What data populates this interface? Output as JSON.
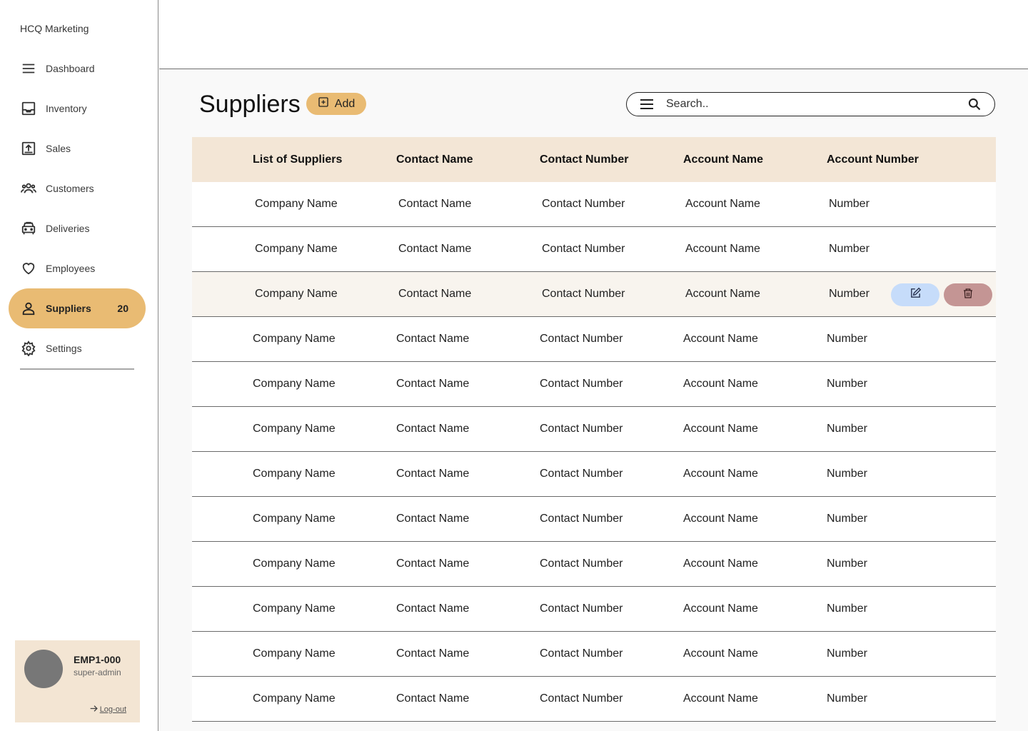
{
  "brand": "HCQ Marketing",
  "nav": [
    {
      "label": "Dashboard",
      "icon": "menu-icon"
    },
    {
      "label": "Inventory",
      "icon": "inbox-icon"
    },
    {
      "label": "Sales",
      "icon": "upload-box-icon"
    },
    {
      "label": "Customers",
      "icon": "people-icon"
    },
    {
      "label": "Deliveries",
      "icon": "car-icon"
    },
    {
      "label": "Employees",
      "icon": "heart-icon"
    },
    {
      "label": "Suppliers",
      "icon": "person-icon",
      "badge": "20",
      "active": true
    },
    {
      "label": "Settings",
      "icon": "gear-icon"
    }
  ],
  "user": {
    "id": "EMP1-000",
    "role": "super-admin",
    "logout_label": "Log-out"
  },
  "page": {
    "title": "Suppliers",
    "add_label": "Add"
  },
  "search": {
    "placeholder": "Search..",
    "value": ""
  },
  "table": {
    "headers": [
      "List of Suppliers",
      "Contact Name",
      "Contact Number",
      "Account Name",
      "Account Number"
    ],
    "rows": [
      [
        "Company Name",
        "Contact Name",
        "Contact Number",
        "Account Name",
        "Number"
      ],
      [
        "Company Name",
        "Contact Name",
        "Contact Number",
        "Account Name",
        "Number"
      ],
      [
        "Company Name",
        "Contact Name",
        "Contact Number",
        "Account Name",
        "Number"
      ],
      [
        "Company Name",
        "Contact Name",
        "Contact Number",
        "Account Name",
        "Number"
      ],
      [
        "Company Name",
        "Contact Name",
        "Contact Number",
        "Account Name",
        "Number"
      ],
      [
        "Company Name",
        "Contact Name",
        "Contact Number",
        "Account Name",
        "Number"
      ],
      [
        "Company Name",
        "Contact Name",
        "Contact Number",
        "Account Name",
        "Number"
      ],
      [
        "Company Name",
        "Contact Name",
        "Contact Number",
        "Account Name",
        "Number"
      ],
      [
        "Company Name",
        "Contact Name",
        "Contact Number",
        "Account Name",
        "Number"
      ],
      [
        "Company Name",
        "Contact Name",
        "Contact Number",
        "Account Name",
        "Number"
      ],
      [
        "Company Name",
        "Contact Name",
        "Contact Number",
        "Account Name",
        "Number"
      ],
      [
        "Company Name",
        "Contact Name",
        "Contact Number",
        "Account Name",
        "Number"
      ]
    ],
    "highlighted_row": 2,
    "row_actions": [
      "edit-icon",
      "trash-icon"
    ]
  },
  "colors": {
    "accent": "#e9bb73",
    "header_bg": "#f3e6d6",
    "edit_bg": "#c6dcfa",
    "delete_bg": "#c49594",
    "user_card_bg": "#f3e5d3"
  }
}
